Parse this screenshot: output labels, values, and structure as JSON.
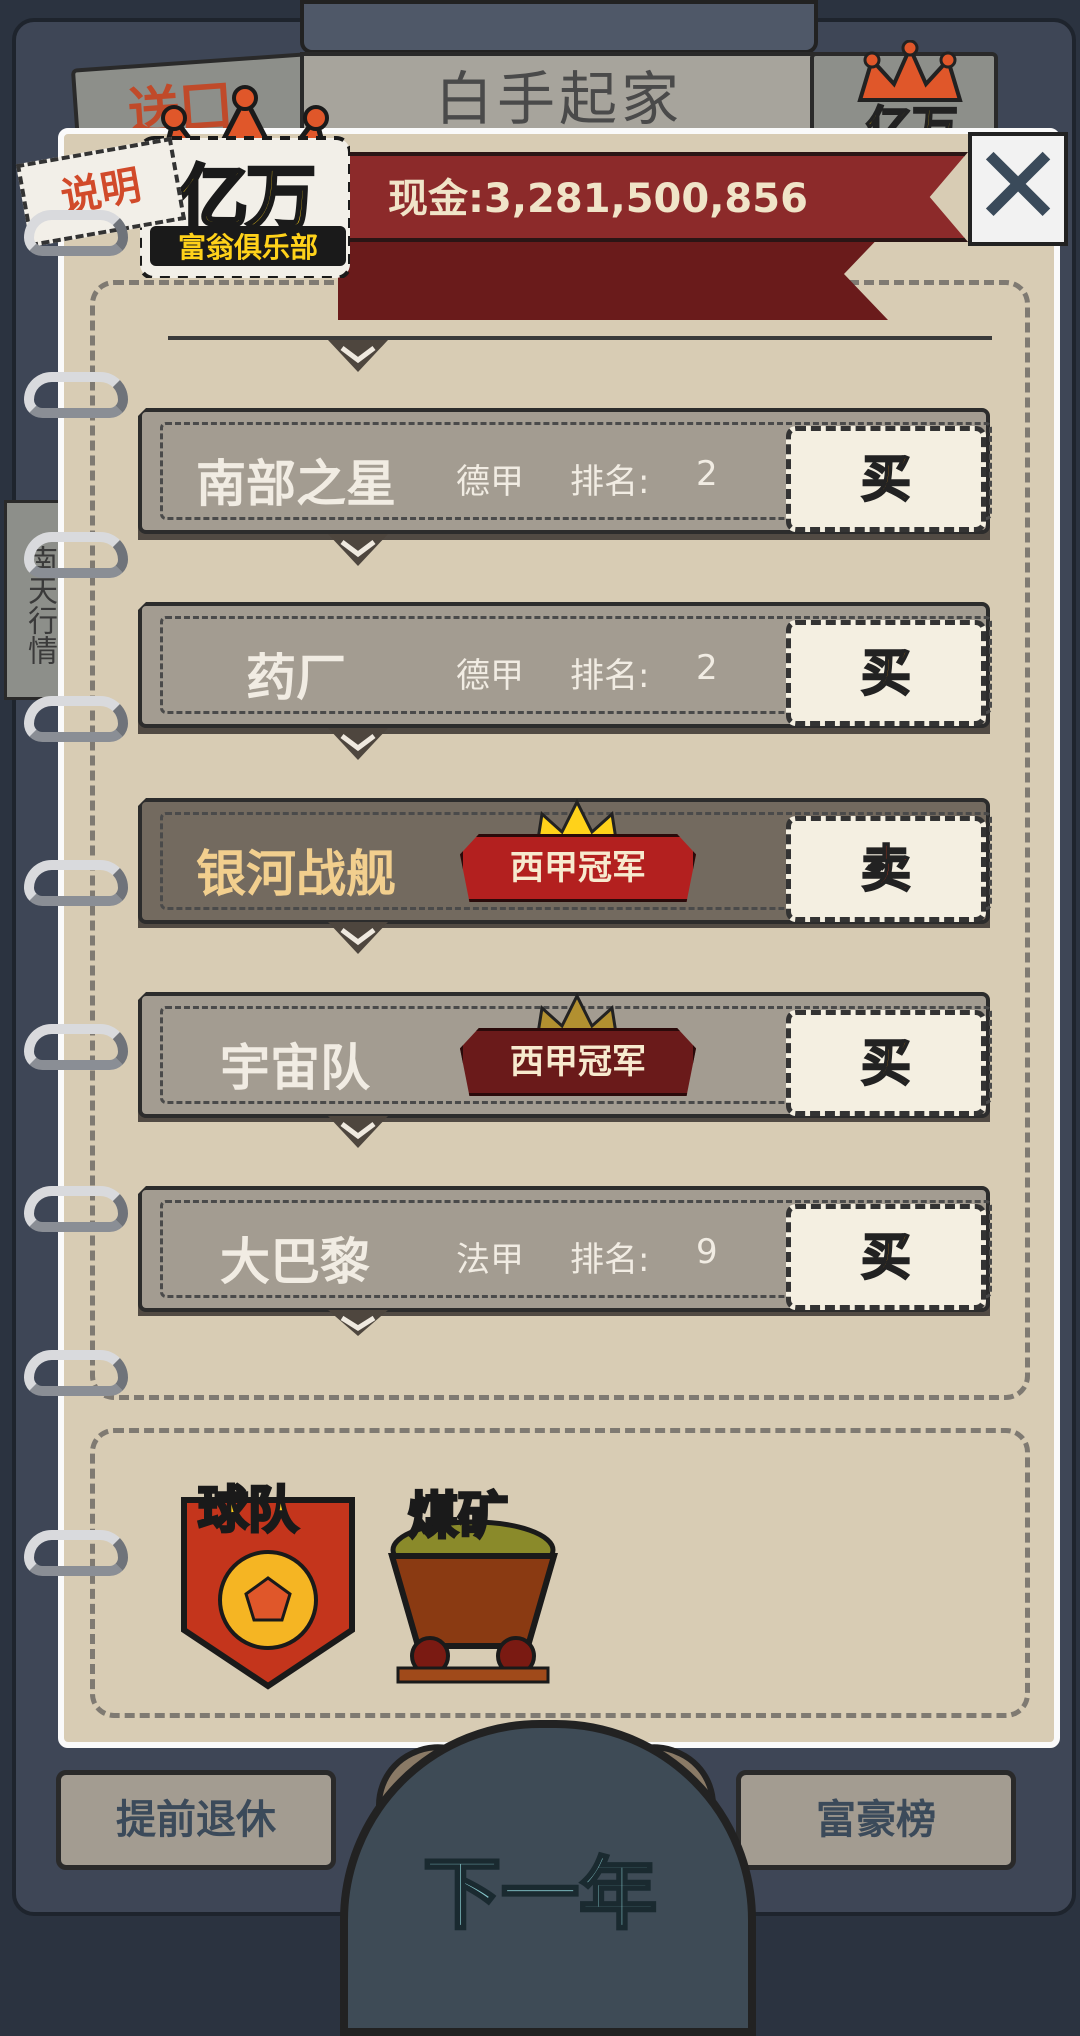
{
  "header": {
    "title": "白手起家",
    "top_tab_partial": "送囗",
    "top_right_label": "亿万",
    "close_symbol": "✕",
    "cash_label": "现金:",
    "cash_value": "3,281,500,856"
  },
  "logo": {
    "title": "亿万",
    "subtitle": "富翁俱乐部"
  },
  "side_tab": "南天行情",
  "instructions_button": "说明",
  "teams": [
    {
      "name": "南部之星",
      "league": "德甲",
      "rank_label": "排名:",
      "rank": "2",
      "action": "买"
    },
    {
      "name": "药厂",
      "league": "德甲",
      "rank_label": "排名:",
      "rank": "2",
      "action": "买"
    },
    {
      "name": "银河战舰",
      "badge": "西甲冠军",
      "action": "卖"
    },
    {
      "name": "宇宙队",
      "badge": "西甲冠军",
      "action": "买"
    },
    {
      "name": "大巴黎",
      "league": "法甲",
      "rank_label": "排名:",
      "rank": "9",
      "action": "买"
    }
  ],
  "categories": [
    {
      "label": "球队",
      "icon": "soccer-pennant-icon"
    },
    {
      "label": "煤矿",
      "icon": "mine-cart-icon"
    }
  ],
  "footer": {
    "retire_label": "提前退休",
    "rich_list_label": "富豪榜",
    "next_year_label": "下一年"
  },
  "colors": {
    "buy": "#f49a12",
    "sell": "#e23b18",
    "ribbon": "#8c2a2a",
    "paper": "#d8ccb4",
    "gold": "#ffd21a"
  }
}
